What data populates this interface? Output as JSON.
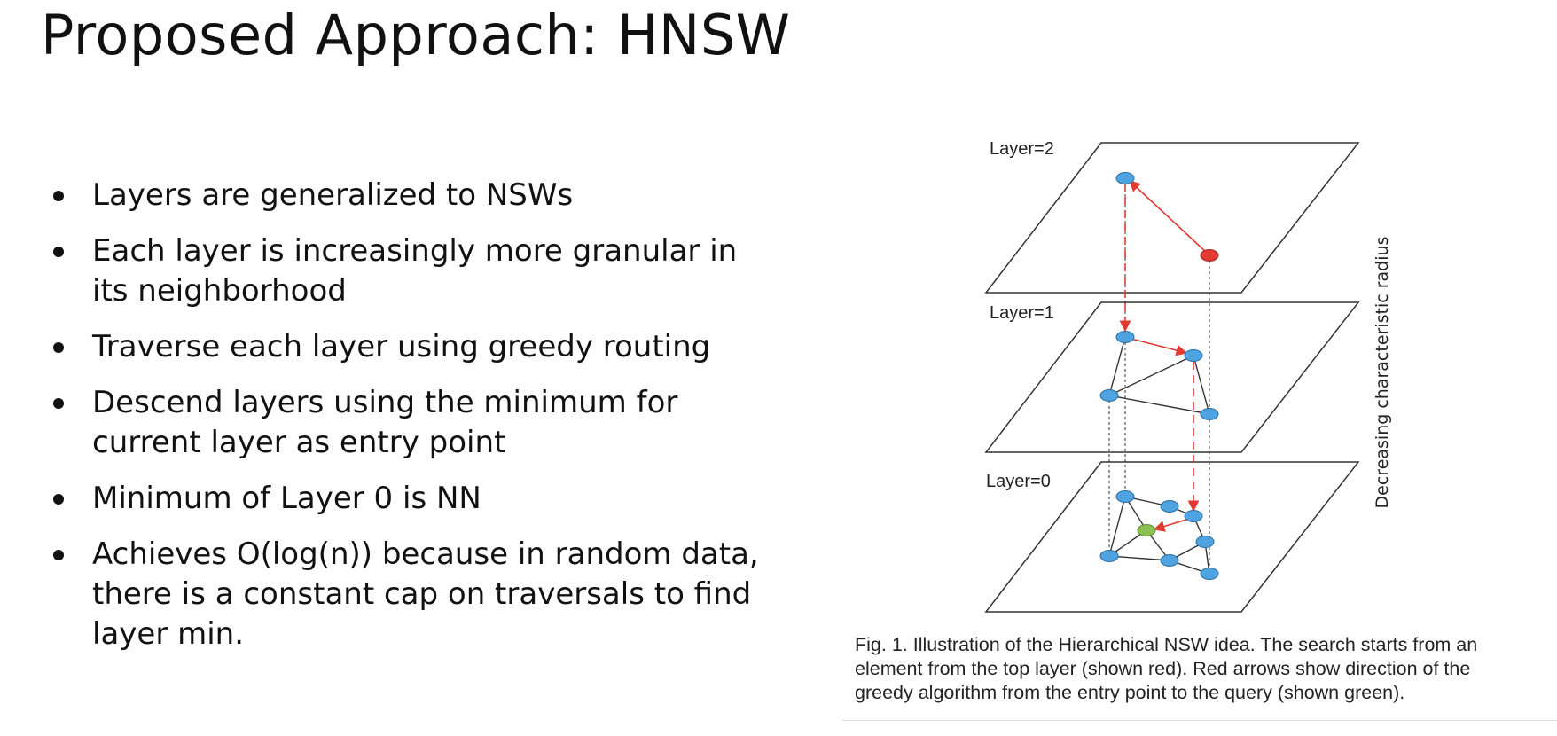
{
  "slide": {
    "title": "Proposed Approach: HNSW",
    "bullets": [
      "Layers are generalized to NSWs",
      "Each layer is increasingly more granular in its neighborhood",
      "Traverse each layer using greedy routing",
      "Descend layers using the minimum for current layer as entry point",
      "Minimum of Layer 0 is NN",
      "Achieves O(log(n)) because in random data, there is a constant cap on traversals to find layer min."
    ]
  },
  "figure": {
    "layer_labels": [
      "Layer=2",
      "Layer=1",
      "Layer=0"
    ],
    "axis_label": "Decreasing characteristic radius",
    "caption": "Fig. 1. Illustration of the Hierarchical NSW idea. The search starts from an element from the top layer (shown red). Red arrows show direction of the greedy algorithm from the entry point to the query (shown green).",
    "colors": {
      "node": "#4fa3e0",
      "entry_node": "#e03a31",
      "query_node": "#8cc152",
      "search_arrow": "#e03a31"
    }
  }
}
